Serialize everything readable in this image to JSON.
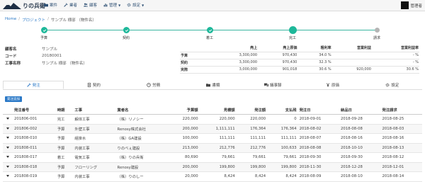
{
  "header": {
    "logo_text": "りの兵衛",
    "nav": [
      {
        "label": "案件",
        "icon": "folder-icon"
      },
      {
        "label": "業者",
        "icon": "wrench-icon"
      },
      {
        "label": "顧客",
        "icon": "users-icon"
      },
      {
        "label": "管理",
        "icon": "bar-chart-icon"
      },
      {
        "label": "設定",
        "icon": "gear-icon"
      }
    ],
    "user_name": "管理者"
  },
  "breadcrumb": [
    "Home",
    "プロジェクト",
    "サンプル 様邸 （物件名）"
  ],
  "steps": [
    {
      "label": "予算",
      "state": "done"
    },
    {
      "label": "契約",
      "state": "done"
    },
    {
      "label": "着工",
      "state": "done"
    },
    {
      "label": "完工",
      "state": "current"
    },
    {
      "label": "請求",
      "state": "pending"
    }
  ],
  "info": [
    {
      "key": "顧客名",
      "value": "サンプル"
    },
    {
      "key": "コード",
      "value": "20180001"
    },
    {
      "key": "工事名称",
      "value": "サンプル 様邸 （物件名）"
    }
  ],
  "finance": {
    "headers": [
      "",
      "売上",
      "売上原価",
      "粗利率",
      "営業利益",
      "営業利益率"
    ],
    "rows": [
      [
        "予算",
        "3,300,000",
        "970,430",
        "34.0 %",
        "",
        "- %"
      ],
      [
        "契約",
        "3,300,000",
        "970,430",
        "32.3 %",
        "",
        "- %"
      ],
      [
        "実際",
        "3,000,000",
        "901,018",
        "30.6 %",
        "920,000",
        "30.6 %"
      ]
    ]
  },
  "tabs": [
    {
      "label": "発注",
      "icon": "wrench-icon",
      "active": true
    },
    {
      "label": "契約",
      "icon": "document-icon",
      "active": false
    },
    {
      "label": "労務",
      "icon": "clock-icon",
      "active": false
    },
    {
      "label": "書類",
      "icon": "folder-icon",
      "active": false
    },
    {
      "label": "議事録",
      "icon": "comments-icon",
      "active": false
    },
    {
      "label": "原価",
      "icon": "yen-icon",
      "active": false
    },
    {
      "label": "設定",
      "icon": "gear-icon",
      "active": false
    }
  ],
  "add_button": "発注追加",
  "orders": {
    "headers": [
      "",
      "発注番号",
      "時期",
      "工事",
      "業者名",
      "予算額",
      "見積額",
      "発注額",
      "支払残",
      "発注日",
      "納品日",
      "発注請求"
    ],
    "rows": [
      [
        "201806-001",
        "完工",
        "解体工事",
        "（株）リノシー",
        "220,000",
        "220,000",
        "220,000",
        "0",
        "2018-09-01",
        "2018-09-28",
        "2018-08-25"
      ],
      [
        "201806-002",
        "予算",
        "外壁工事",
        "Renosy株式会社",
        "200,000",
        "1,111,111",
        "176,364",
        "176,364",
        "2018-08-02",
        "2018-08-08",
        "2018-08-03"
      ],
      [
        "201808-010",
        "予算",
        "組掛水",
        "（株）GA建設",
        "100,000",
        "111,111",
        "111,111",
        "111,111",
        "2018-08-07",
        "2018-08-16",
        "2018-08-16"
      ],
      [
        "201808-011",
        "予算",
        "内装工事",
        "りのべぇ建設",
        "213,000",
        "212,776",
        "212,776",
        "100,633",
        "2018-08-08",
        "2018-10-10",
        "2018-08-13"
      ],
      [
        "201808-017",
        "着工",
        "電気工事",
        "（株）りの兵衛",
        "80,690",
        "79,661",
        "79,661",
        "79,661",
        "2018-09-30",
        "2018-09-30",
        "2018-08-12"
      ],
      [
        "201808-018",
        "予算",
        "フローリング",
        "Renosy建設",
        "200,000",
        "199,800",
        "199,800",
        "199,800",
        "2018-11-30",
        "2018-12-28",
        "2018-12-01"
      ],
      [
        "201808-019",
        "予算",
        "内装工事",
        "（株）りのしー",
        "20,000",
        "8,424",
        "8,424",
        "8,424",
        "2018-08-09",
        "2018-08-10",
        "2018-08-14"
      ]
    ]
  },
  "colors": {
    "accent": "#2b79c7",
    "progress": "#1eb89a",
    "pending": "#b5b5b5"
  }
}
